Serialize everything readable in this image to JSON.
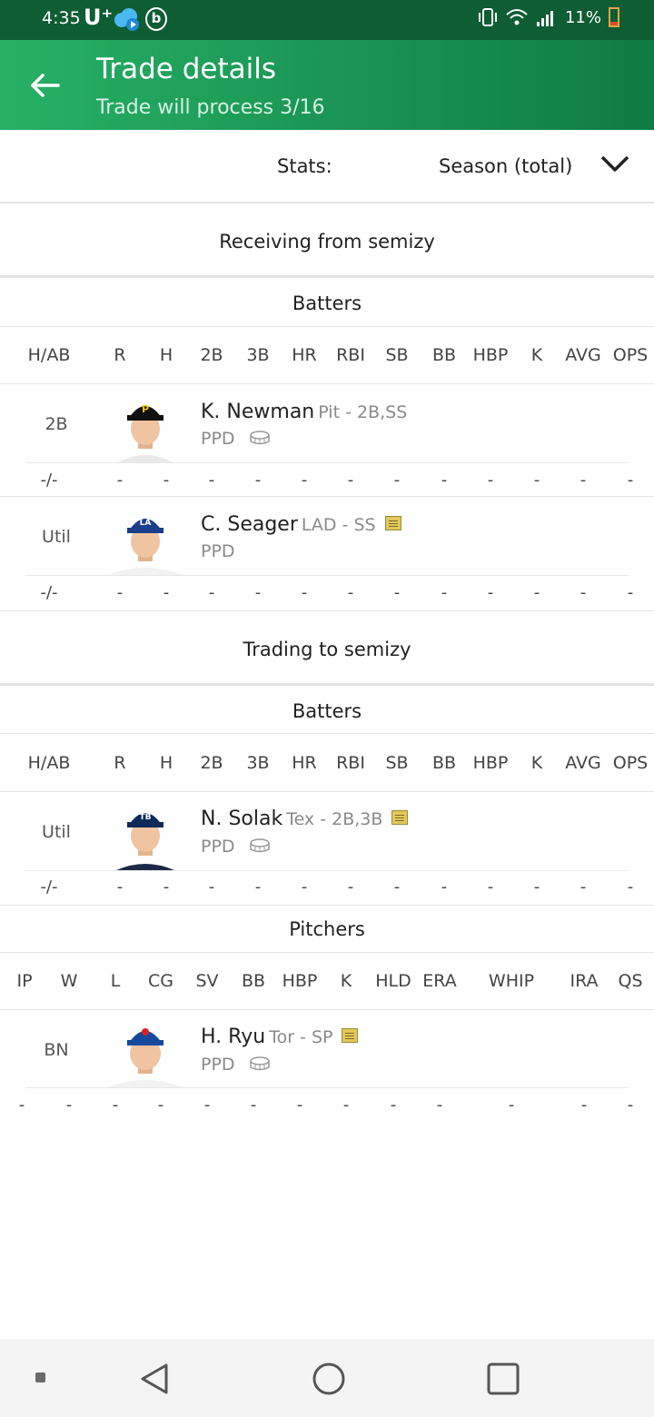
{
  "status_bar": {
    "time": "4:35",
    "carrier": "U⁺",
    "battery": "11%",
    "icons": [
      "cloud-icon",
      "b-app-icon",
      "vibrate-icon",
      "wifi-icon",
      "signal-icon",
      "battery-icon"
    ]
  },
  "header": {
    "title": "Trade details",
    "subtitle": "Trade will process 3/16",
    "back_icon": "arrow-left-icon"
  },
  "stats_selector": {
    "label": "Stats:",
    "value": "Season (total)",
    "icon": "chevron-down-icon"
  },
  "columns": {
    "batters": [
      "H/AB",
      "R",
      "H",
      "2B",
      "3B",
      "HR",
      "RBI",
      "SB",
      "BB",
      "HBP",
      "K",
      "AVG",
      "OPS"
    ],
    "pitchers": [
      "IP",
      "W",
      "L",
      "CG",
      "SV",
      "BB",
      "HBP",
      "K",
      "HLD",
      "ERA",
      "WHIP",
      "IRA",
      "QS"
    ]
  },
  "receiving": {
    "title": "Receiving from semizy",
    "group_title": "Batters",
    "players": [
      {
        "position": "2B",
        "name": "K. Newman",
        "team_pos": "Pit - 2B,SS",
        "status": "PPD",
        "icon": "stadium-icon",
        "stats": [
          "-/-",
          "-",
          "-",
          "-",
          "-",
          "-",
          "-",
          "-",
          "-",
          "-",
          "-",
          "-",
          "-"
        ]
      },
      {
        "position": "Util",
        "name": "C. Seager",
        "team_pos": "LAD - SS",
        "status": "PPD",
        "icon": "note-icon",
        "stats": [
          "-/-",
          "-",
          "-",
          "-",
          "-",
          "-",
          "-",
          "-",
          "-",
          "-",
          "-",
          "-",
          "-"
        ]
      }
    ]
  },
  "trading": {
    "title": "Trading to semizy",
    "batters_title": "Batters",
    "pitchers_title": "Pitchers",
    "batters": [
      {
        "position": "Util",
        "name": "N. Solak",
        "team_pos": "Tex - 2B,3B",
        "status": "PPD",
        "icons": [
          "note-icon",
          "stadium-icon"
        ],
        "stats": [
          "-/-",
          "-",
          "-",
          "-",
          "-",
          "-",
          "-",
          "-",
          "-",
          "-",
          "-",
          "-",
          "-"
        ]
      }
    ],
    "pitchers": [
      {
        "position": "BN",
        "name": "H. Ryu",
        "team_pos": "Tor - SP",
        "status": "PPD",
        "icons": [
          "note-icon",
          "stadium-icon"
        ],
        "stats": [
          "-",
          "-",
          "-",
          "-",
          "-",
          "-",
          "-",
          "-",
          "-",
          "-",
          "-",
          "-",
          "-"
        ]
      }
    ]
  },
  "nav_bar": {
    "icons": [
      "recents-icon",
      "back-triangle-icon",
      "home-circle-icon",
      "overview-square-icon"
    ]
  },
  "colors": {
    "header_start": "#27b066",
    "header_end": "#0f7c43",
    "status_bar": "#0f5d33",
    "note_icon": "#e3c85a"
  }
}
